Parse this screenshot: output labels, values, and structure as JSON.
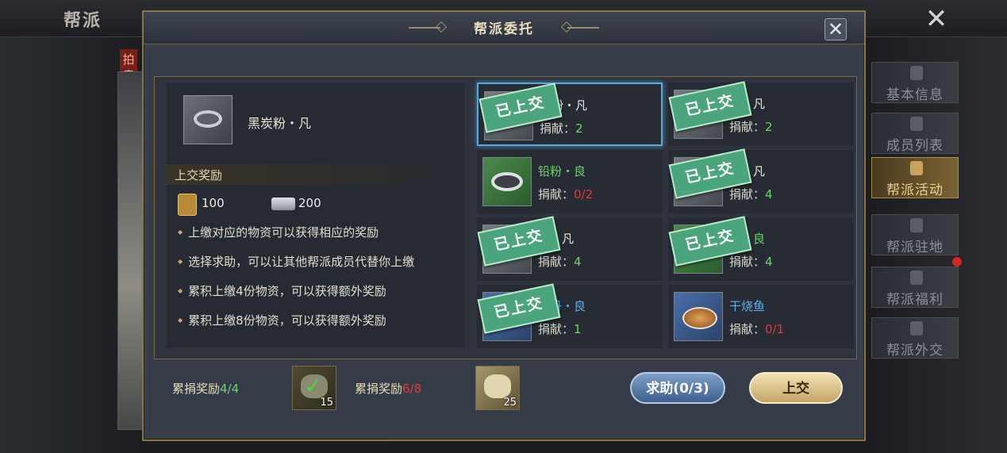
{
  "background": {
    "title": "帮派",
    "vertical_banner": "拍卖奖励",
    "side_tabs": [
      {
        "label": "基本信息",
        "active": false
      },
      {
        "label": "成员列表",
        "active": false
      },
      {
        "label": "帮派活动",
        "active": true
      },
      {
        "label": "帮派驻地",
        "active": false
      },
      {
        "label": "帮派福利",
        "active": false
      },
      {
        "label": "帮派外交",
        "active": false
      }
    ]
  },
  "dialog": {
    "title": "帮派委托",
    "selected_item": {
      "name": "黑炭粉・凡",
      "icon": "ring-bowl-icon"
    },
    "reward_title": "上交奖励",
    "rewards": [
      {
        "icon": "guild-token-icon",
        "value": "100"
      },
      {
        "icon": "silver-ingot-icon",
        "value": "200"
      }
    ],
    "rules": [
      "上缴对应的物资可以获得相应的奖励",
      "选择求助，可以让其他帮派成员代替你上缴",
      "累积上缴4份物资，可以获得额外奖励",
      "累积上缴8份物资，可以获得额外奖励"
    ],
    "donate_label": "捐献：",
    "submitted_stamp": "已上交",
    "items": [
      {
        "name": "炭粉・凡",
        "donation": "2",
        "quality": "white",
        "submitted": true
      },
      {
        "name": "芍・凡",
        "donation": "2",
        "quality": "white",
        "submitted": true
      },
      {
        "name": "铅粉・良",
        "donation": "0/2",
        "quality": "green",
        "submitted": false
      },
      {
        "name": "芍・凡",
        "donation": "4",
        "quality": "white",
        "submitted": true
      },
      {
        "name": "矿・凡",
        "donation": "4",
        "quality": "white",
        "submitted": true
      },
      {
        "name": "归・良",
        "donation": "4",
        "quality": "green",
        "submitted": true
      },
      {
        "name": "心丹・良",
        "donation": "1",
        "quality": "blue",
        "submitted": true
      },
      {
        "name": "干烧鱼",
        "donation": "0/1",
        "quality": "white",
        "submitted": false
      }
    ],
    "cumulative": [
      {
        "label": "累捐奖励",
        "progress": "4/4",
        "count": "15",
        "claimed": true
      },
      {
        "label": "累捐奖励",
        "progress": "6/8",
        "count": "25",
        "claimed": false
      }
    ],
    "help_button": "求助(0/3)",
    "submit_button": "上交"
  }
}
